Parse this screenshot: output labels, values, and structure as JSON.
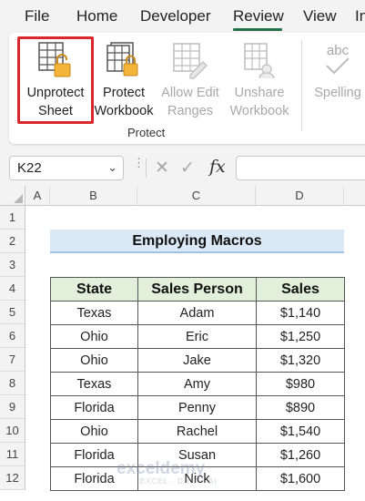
{
  "ribbon_tabs": [
    {
      "label": "File"
    },
    {
      "label": "Home"
    },
    {
      "label": "Developer"
    },
    {
      "label": "Review"
    },
    {
      "label": "View"
    },
    {
      "label": "In"
    }
  ],
  "active_tab": "Review",
  "protect_group": {
    "label": "Protect",
    "buttons": [
      {
        "line1": "Unprotect",
        "line2": "Sheet",
        "icon": "unprotect-sheet-icon",
        "enabled": true
      },
      {
        "line1": "Protect",
        "line2": "Workbook",
        "icon": "protect-workbook-icon",
        "enabled": true
      },
      {
        "line1": "Allow Edit",
        "line2": "Ranges",
        "icon": "allow-edit-ranges-icon",
        "enabled": false
      },
      {
        "line1": "Unshare",
        "line2": "Workbook",
        "icon": "unshare-workbook-icon",
        "enabled": false
      }
    ]
  },
  "next_group_button": {
    "label": "Spelling",
    "icon_text": "abc",
    "enabled": false
  },
  "formula_bar": {
    "name_box": "K22",
    "fx_label": "fx",
    "formula": ""
  },
  "columns": [
    "A",
    "B",
    "C",
    "D"
  ],
  "rows": [
    "1",
    "2",
    "3",
    "4",
    "5",
    "6",
    "7",
    "8",
    "9",
    "10",
    "11",
    "12"
  ],
  "sheet": {
    "title": "Employing Macros",
    "headers": [
      "State",
      "Sales Person",
      "Sales"
    ],
    "data": [
      [
        "Texas",
        "Adam",
        "$1,140"
      ],
      [
        "Ohio",
        "Eric",
        "$1,250"
      ],
      [
        "Ohio",
        "Jake",
        "$1,320"
      ],
      [
        "Texas",
        "Amy",
        "$980"
      ],
      [
        "Florida",
        "Penny",
        "$890"
      ],
      [
        "Ohio",
        "Rachel",
        "$1,540"
      ],
      [
        "Florida",
        "Susan",
        "$1,260"
      ],
      [
        "Florida",
        "Nick",
        "$1,600"
      ]
    ]
  },
  "watermark": {
    "brand": "exceldemy",
    "tagline": "EXCEL · DATA · BI"
  },
  "colors": {
    "accent_green": "#217346",
    "highlight_red": "#d9262c",
    "title_fill": "#dbe9f7",
    "header_fill": "#e2efda"
  }
}
